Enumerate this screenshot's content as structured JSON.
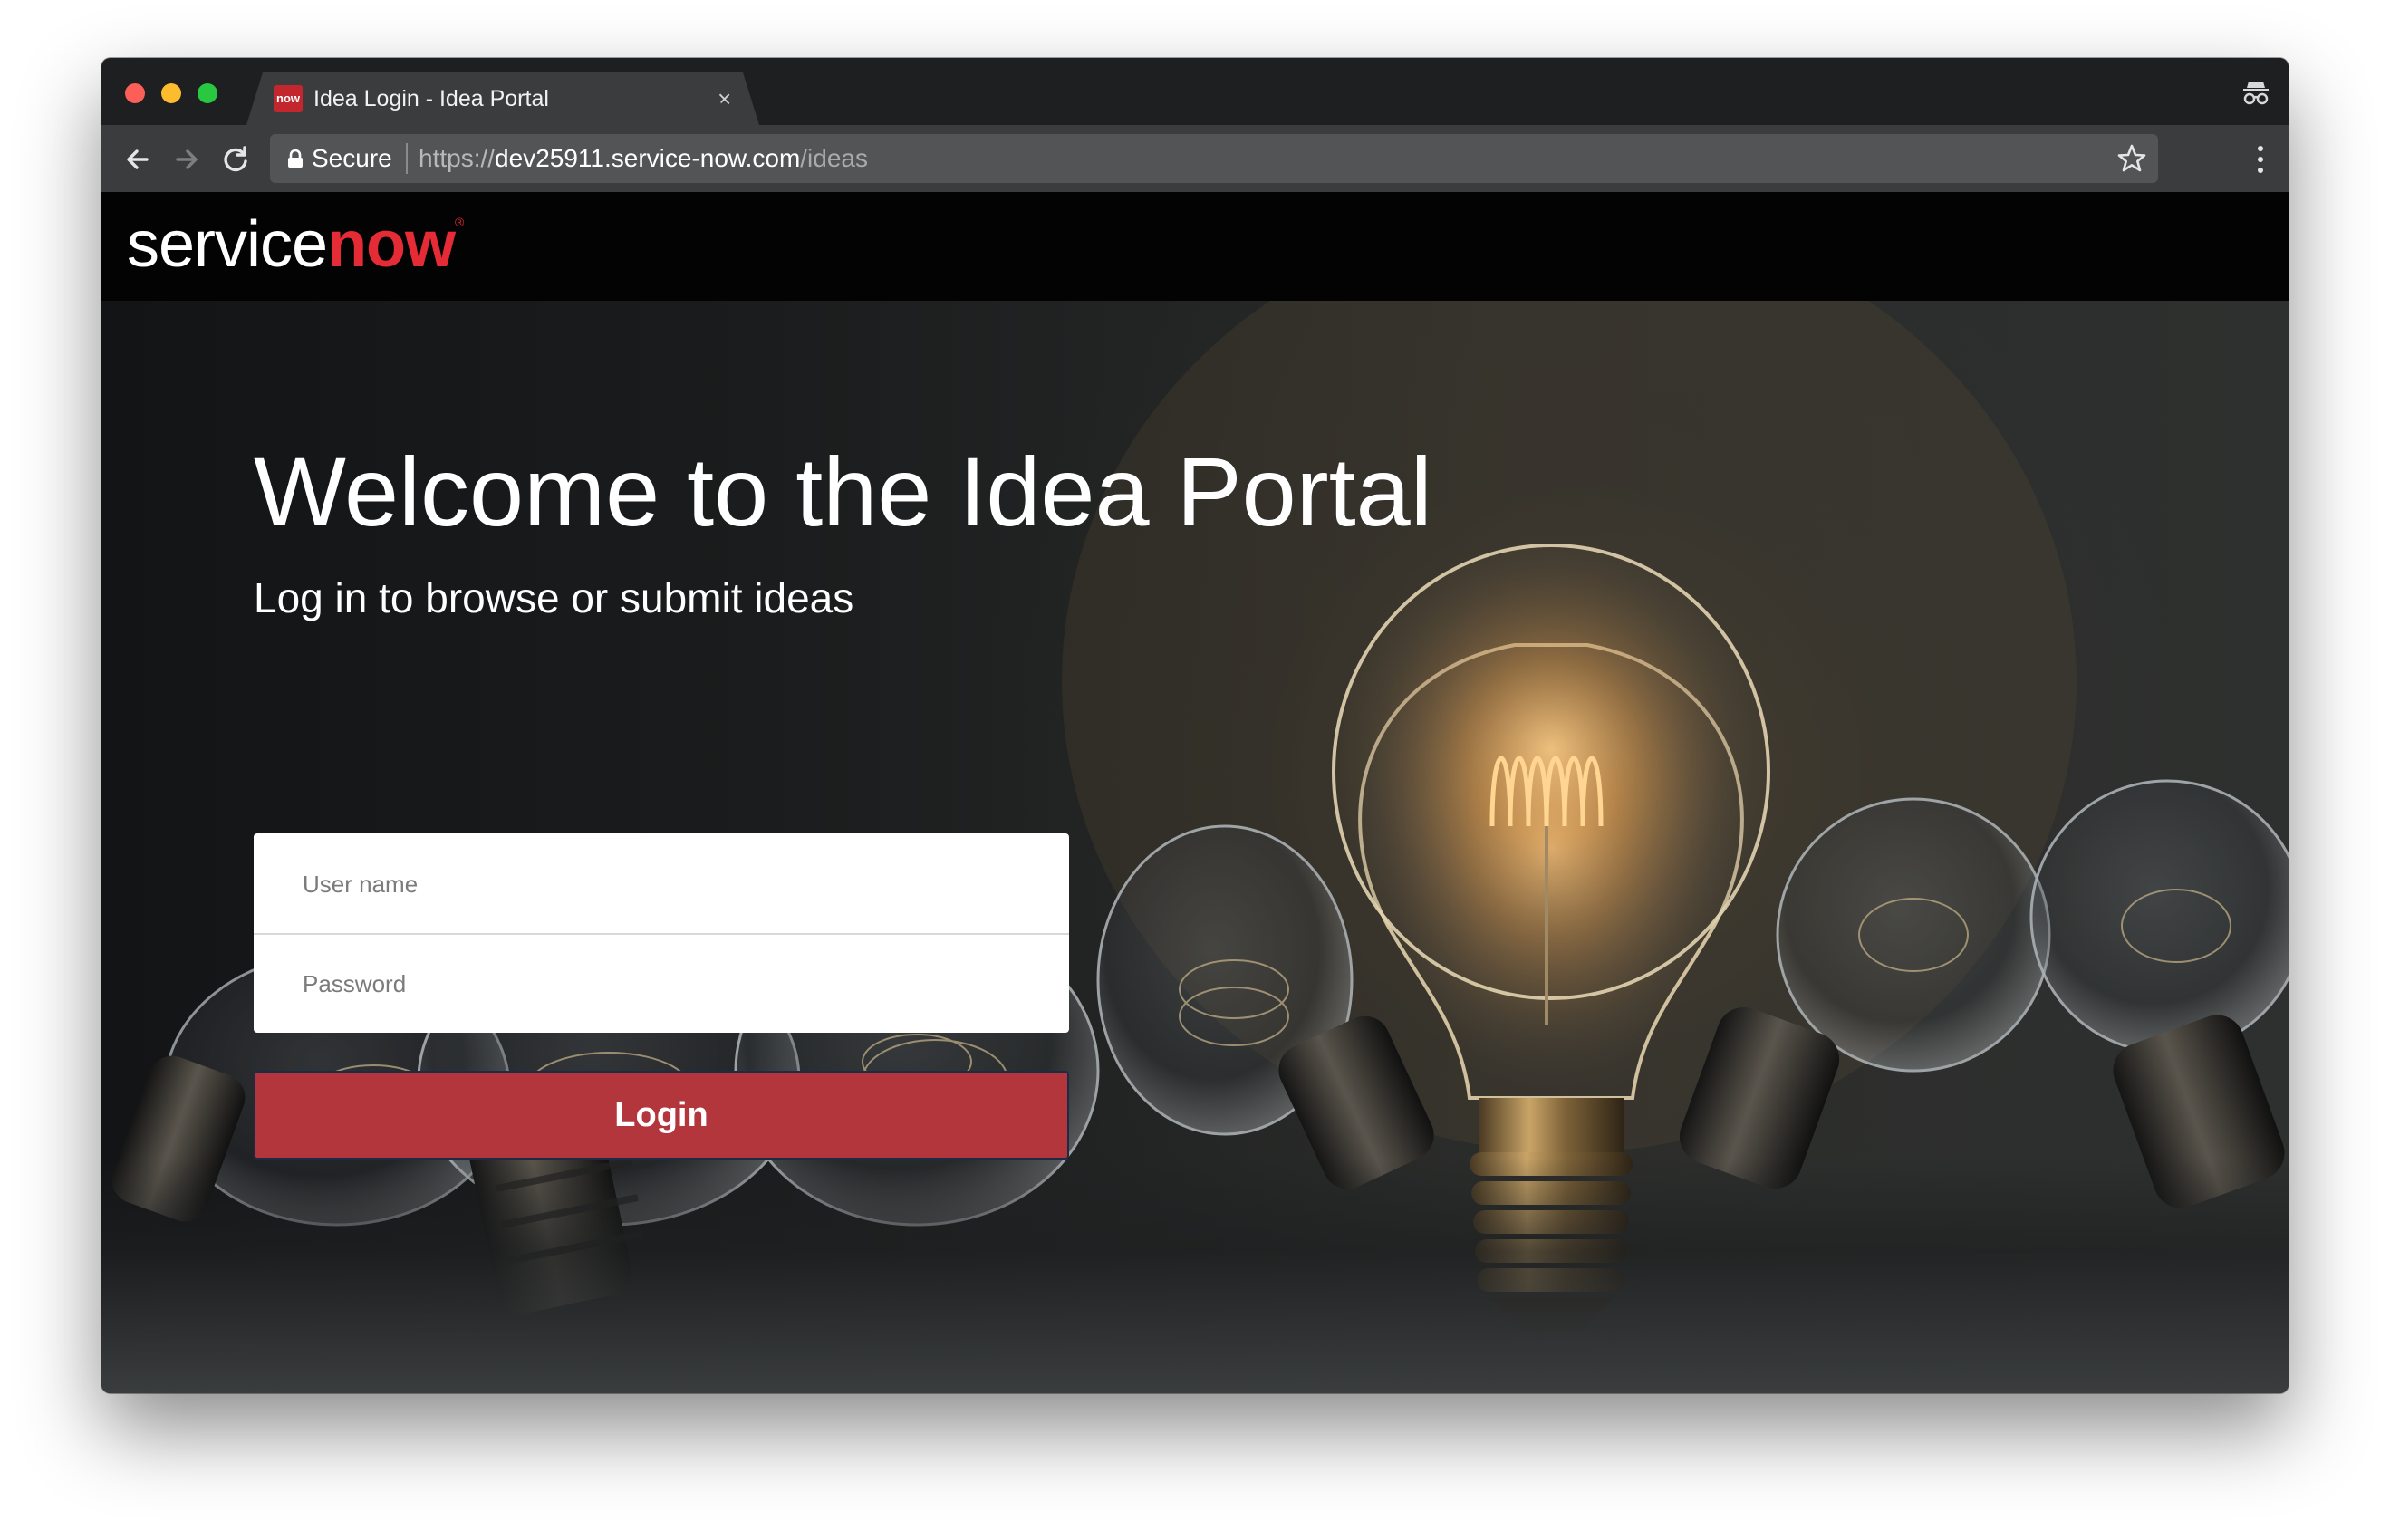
{
  "browser": {
    "tab": {
      "favicon_text": "now",
      "title": "Idea Login - Idea Portal",
      "close_glyph": "×"
    },
    "toolbar": {
      "secure_label": "Secure",
      "url_scheme": "https://",
      "url_host": "dev25911.service-now.com",
      "url_path": "/ideas"
    },
    "icons": [
      "back-icon",
      "forward-icon",
      "reload-icon",
      "lock-icon",
      "star-icon",
      "menu-icon",
      "incognito-icon",
      "close-icon"
    ]
  },
  "header": {
    "logo_service": "service",
    "logo_now": "now",
    "logo_mark": "®"
  },
  "hero": {
    "title": "Welcome to the Idea Portal",
    "subtitle": "Log in to browse or submit ideas"
  },
  "login_form": {
    "username_placeholder": "User name",
    "password_placeholder": "Password",
    "login_label": "Login"
  },
  "colors": {
    "brand_red": "#e52c36",
    "login_button": "#b3363d",
    "header_bg": "#030303"
  }
}
